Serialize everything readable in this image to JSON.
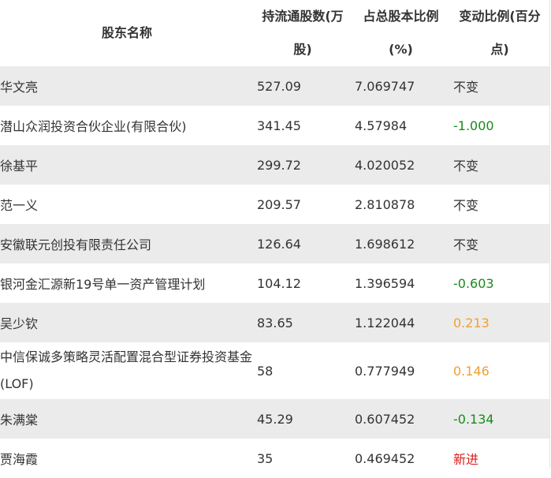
{
  "header": {
    "holder_name": "股东名称",
    "float_shares": "持流通股数(万股)",
    "ratio": "占总股本比例(%)",
    "change_ratio": "变动比例(百分点)"
  },
  "rows": [
    {
      "name": "华文亮",
      "shares": "527.09",
      "ratio": "7.069747",
      "change": "不变",
      "change_type": "neutral"
    },
    {
      "name": "潜山众润投资合伙企业(有限合伙)",
      "shares": "341.45",
      "ratio": "4.57984",
      "change": "-1.000",
      "change_type": "down"
    },
    {
      "name": "徐基平",
      "shares": "299.72",
      "ratio": "4.020052",
      "change": "不变",
      "change_type": "neutral"
    },
    {
      "name": "范一义",
      "shares": "209.57",
      "ratio": "2.810878",
      "change": "不变",
      "change_type": "neutral"
    },
    {
      "name": "安徽联元创投有限责任公司",
      "shares": "126.64",
      "ratio": "1.698612",
      "change": "不变",
      "change_type": "neutral"
    },
    {
      "name": "银河金汇源新19号单一资产管理计划",
      "shares": "104.12",
      "ratio": "1.396594",
      "change": "-0.603",
      "change_type": "down"
    },
    {
      "name": "吴少钦",
      "shares": "83.65",
      "ratio": "1.122044",
      "change": "0.213",
      "change_type": "up"
    },
    {
      "name": "中信保诚多策略灵活配置混合型证券投资基金(LOF)",
      "shares": "58",
      "ratio": "0.777949",
      "change": "0.146",
      "change_type": "up"
    },
    {
      "name": "朱满棠",
      "shares": "45.29",
      "ratio": "0.607452",
      "change": "-0.134",
      "change_type": "down"
    },
    {
      "name": "贾海霞",
      "shares": "35",
      "ratio": "0.469452",
      "change": "新进",
      "change_type": "new"
    }
  ],
  "colors": {
    "down": "#1a8a1a",
    "up": "#f0a030",
    "new": "#d9201c",
    "stripe": "#ebebeb"
  }
}
